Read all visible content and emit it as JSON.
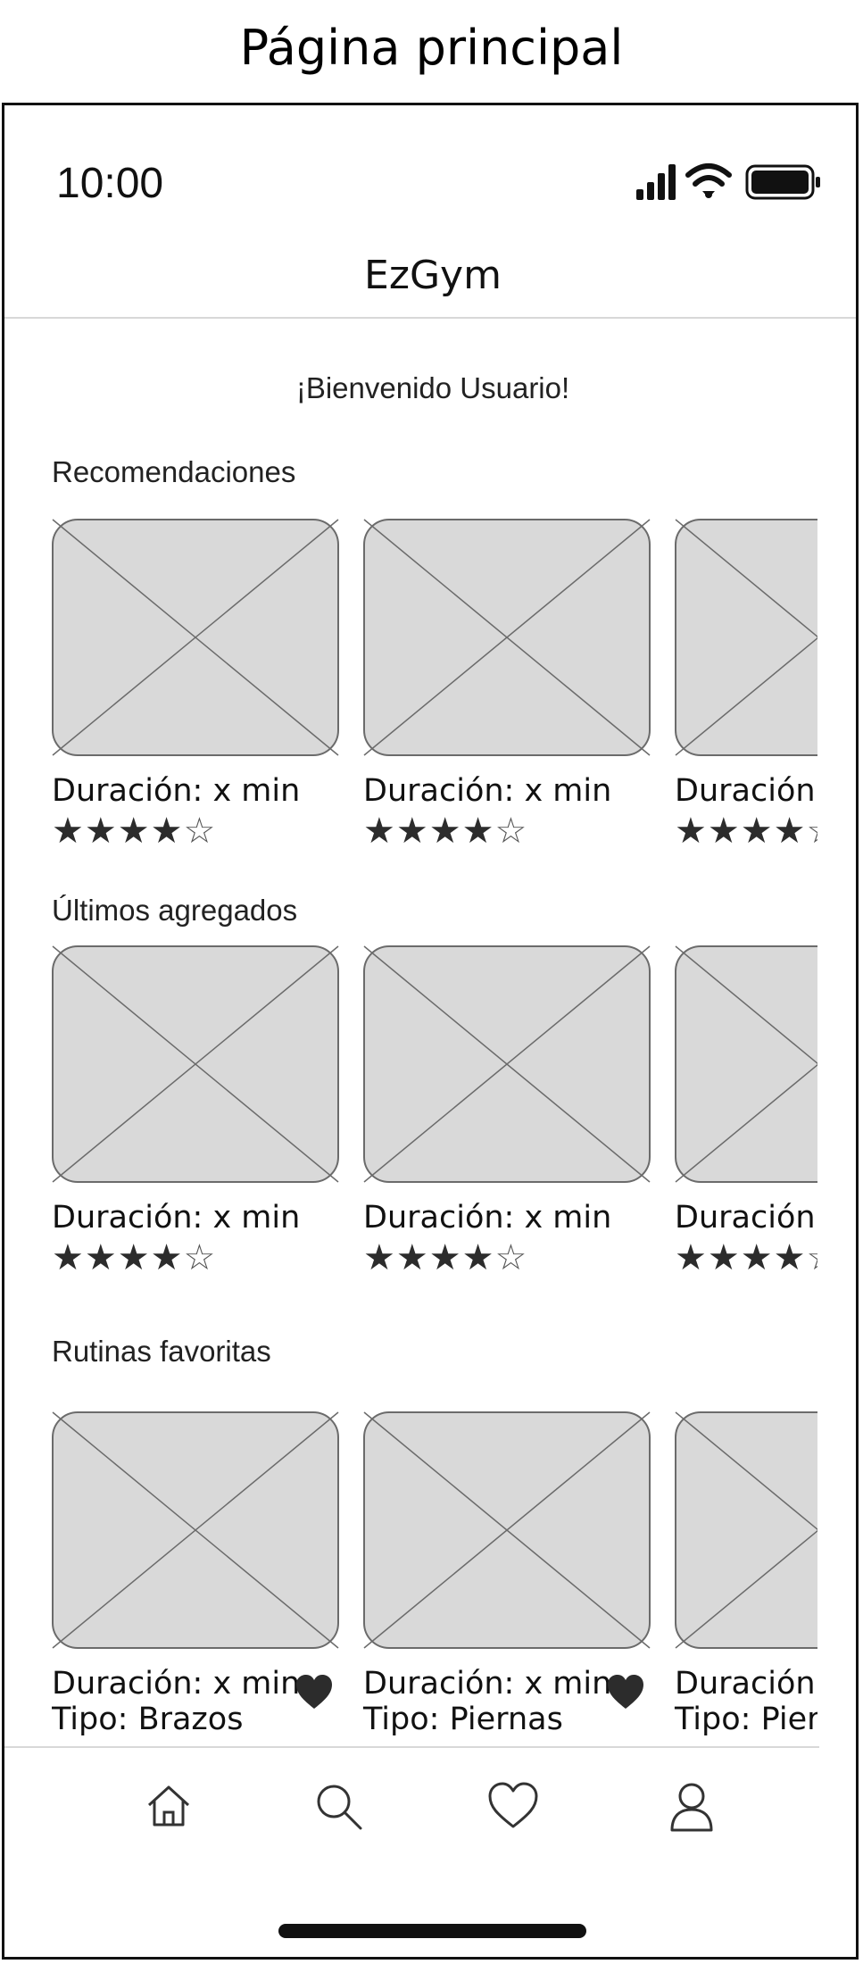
{
  "page_heading": "Página principal",
  "status_bar": {
    "time": "10:00",
    "icons": [
      "signal-icon",
      "wifi-icon",
      "battery-icon"
    ]
  },
  "header": {
    "title": "EzGym"
  },
  "welcome": "¡Bienvenido Usuario!",
  "sections": {
    "recommendations": {
      "title": "Recomendaciones",
      "cards": [
        {
          "duration": "Duración: x min",
          "rating": 4,
          "rating_max": 5
        },
        {
          "duration": "Duración: x min",
          "rating": 4,
          "rating_max": 5
        },
        {
          "duration": "Duración: x min",
          "rating": 4,
          "rating_max": 5
        }
      ]
    },
    "latest": {
      "title": "Últimos agregados",
      "cards": [
        {
          "duration": "Duración: x min",
          "rating": 4,
          "rating_max": 5
        },
        {
          "duration": "Duración: x min",
          "rating": 4,
          "rating_max": 5
        },
        {
          "duration": "Duración: x min",
          "rating": 4,
          "rating_max": 5
        }
      ]
    },
    "favorites": {
      "title": "Rutinas favoritas",
      "cards": [
        {
          "duration": "Duración: x min",
          "type": "Tipo: Brazos"
        },
        {
          "duration": "Duración: x min",
          "type": "Tipo: Piernas"
        },
        {
          "duration": "Duración: x min",
          "type": "Tipo: Piernas"
        }
      ]
    }
  },
  "bottom_nav": [
    "home-icon",
    "search-icon",
    "heart-icon",
    "user-icon"
  ],
  "colors": {
    "placeholder_fill": "#d9d9d9",
    "placeholder_stroke": "#6b6b6b",
    "star": "#2c2c2c",
    "heart": "#2c2c2c"
  }
}
